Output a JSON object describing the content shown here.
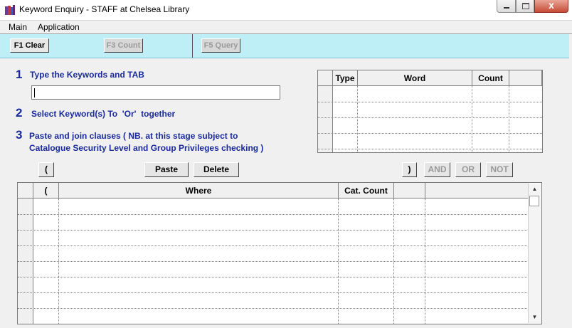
{
  "window": {
    "title": "Keyword Enquiry - STAFF at Chelsea Library",
    "icon": "library-app-icon",
    "close_symbol": "x"
  },
  "menu": [
    "Main",
    "Application"
  ],
  "toolbar": {
    "clear_label": "F1 Clear",
    "count_label": "F3 Count",
    "query_label": "F5 Query"
  },
  "steps": [
    {
      "num": "1",
      "text": "Type the Keywords and TAB"
    },
    {
      "num": "2",
      "text": "Select Keyword(s) To  'Or'  together"
    },
    {
      "num": "3",
      "text": "Paste and join clauses ( NB. at this stage subject to",
      "text2": "Catalogue Security Level and Group Privileges checking )"
    }
  ],
  "keyword_input": {
    "value": ""
  },
  "keyword_grid": {
    "columns": [
      "Type",
      "Word",
      "Count"
    ],
    "rows": []
  },
  "buttons": {
    "open_paren": "(",
    "paste": "Paste",
    "delete": "Delete",
    "close_paren": ")",
    "and": "AND",
    "or": "OR",
    "not": "NOT"
  },
  "where_grid": {
    "columns": [
      "(",
      "Where",
      "Cat. Count",
      ""
    ],
    "rows": []
  },
  "colors": {
    "toolbar_bg": "#bfeff6",
    "step_text": "#1a2a9a"
  }
}
